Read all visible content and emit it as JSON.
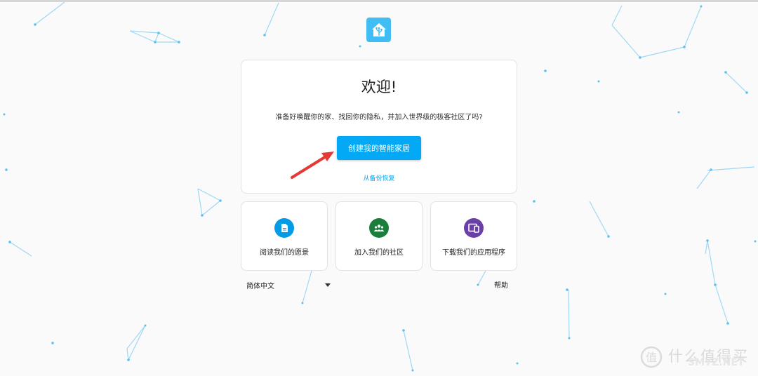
{
  "welcome": {
    "title": "欢迎!",
    "intro": "准备好唤醒你的家、找回你的隐私，并加入世界级的极客社区了吗?",
    "create_button": "创建我的智能家居",
    "restore_link": "从备份恢复"
  },
  "tiles": [
    {
      "label": "阅读我们的愿景",
      "icon": "document-icon",
      "color": "#039be5"
    },
    {
      "label": "加入我们的社区",
      "icon": "community-icon",
      "color": "#1b7d3c"
    },
    {
      "label": "下载我们的应用程序",
      "icon": "devices-icon",
      "color": "#6a3fa8"
    }
  ],
  "footer": {
    "language": "简体中文",
    "help": "帮助"
  },
  "watermark": {
    "text_cn": "什么值得买",
    "text_en": "SMYZ.NET"
  },
  "colors": {
    "accent": "#03a9f4",
    "logo": "#41bdf5",
    "arrow": "#e53935",
    "background": "#fafafa"
  }
}
